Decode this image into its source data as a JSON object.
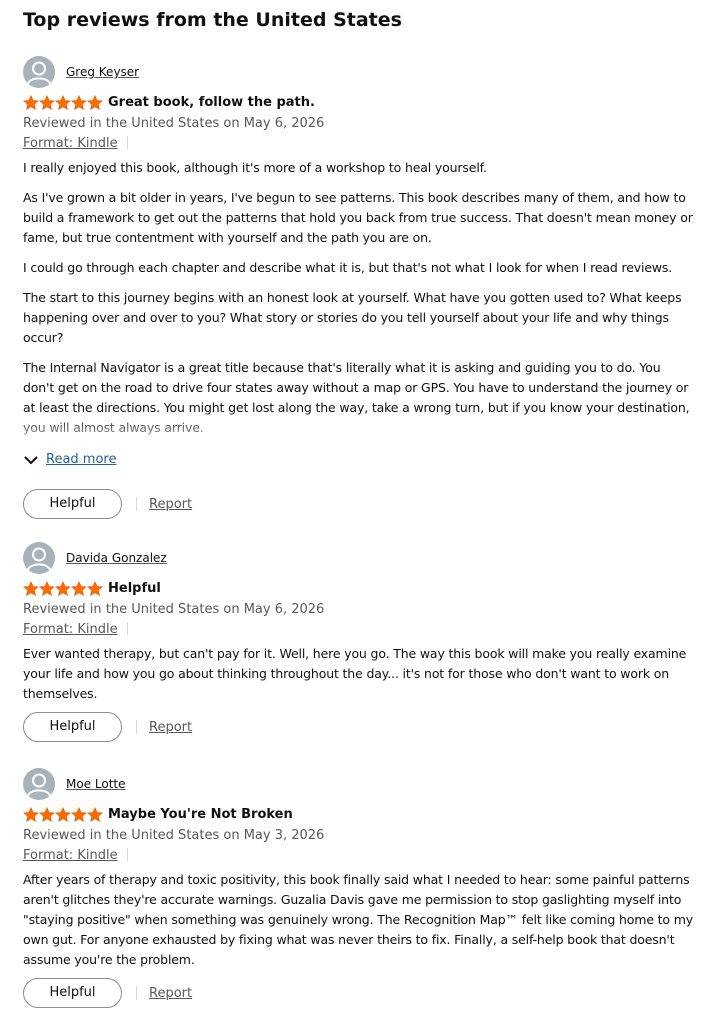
{
  "section_title": "Top reviews from the United States",
  "colors": {
    "star": "#ff6b00",
    "link": "#2162a1",
    "muted": "#565959",
    "avatar": "#a8b2ba"
  },
  "reviews": [
    {
      "author": "Greg Keyser",
      "rating": 5,
      "title": "Great book, follow the path.",
      "date": "Reviewed in the United States on May 6, 2026",
      "format": "Format: Kindle",
      "paragraphs": [
        "I really enjoyed this book, although it's more of a workshop to heal yourself.",
        "As I've grown a bit older in years, I've begun to see patterns. This book describes many of them, and how to build a framework to get out the patterns that hold you back from true success. That doesn't mean money or fame, but true contentment with yourself and the path you are on.",
        "I could go through each chapter and describe what it is, but that's not what I look for when I read reviews.",
        "The start to this journey begins with an honest look at yourself. What have you gotten used to? What keeps happening over and over to you? What story or stories do you tell yourself about your life and why things occur?",
        "The Internal Navigator is a great title because that's literally what it is asking and guiding you to do. You don't get on the road to drive four states away without a map or GPS. You have to understand the journey or at least the directions. You might get lost along the way, take a wrong turn, but if you know your destination, you will almost always arrive."
      ],
      "read_more": "Read more",
      "helpful": "Helpful",
      "report": "Report"
    },
    {
      "author": "Davida Gonzalez",
      "rating": 5,
      "title": "Helpful",
      "date": "Reviewed in the United States on May 6, 2026",
      "format": "Format: Kindle",
      "paragraphs": [
        "Ever wanted therapy, but can't pay for it. Well, here you go. The way this book will make you really examine your life and how you go about thinking throughout the day... it's not for those who don't want to work on themselves."
      ],
      "helpful": "Helpful",
      "report": "Report"
    },
    {
      "author": "Moe Lotte",
      "rating": 5,
      "title": "Maybe You're Not Broken",
      "date": "Reviewed in the United States on May 3, 2026",
      "format": "Format: Kindle",
      "paragraphs": [
        "After years of therapy and toxic positivity, this book finally said what I needed to hear: some painful patterns aren't glitches they're accurate warnings. Guzalia Davis gave me permission to stop gaslighting myself into \"staying positive\" when something was genuinely wrong. The Recognition Map™ felt like coming home to my own gut. For anyone exhausted by fixing what was never theirs to fix. Finally, a self-help book that doesn't assume you're the problem."
      ],
      "helpful": "Helpful",
      "report": "Report"
    }
  ]
}
